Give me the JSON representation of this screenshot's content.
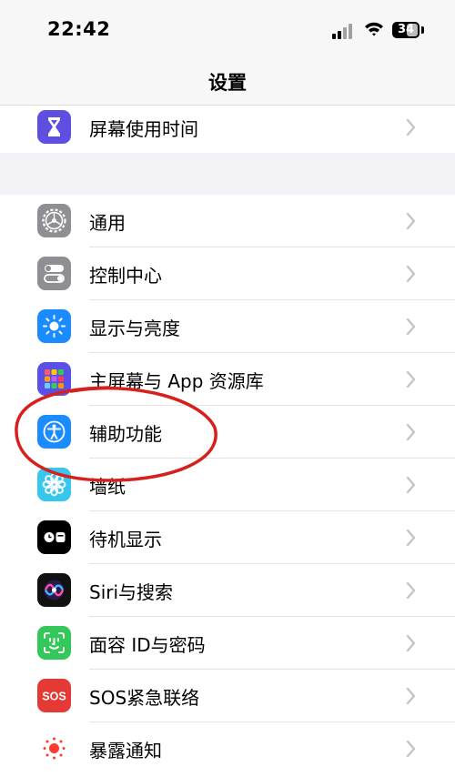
{
  "status_bar": {
    "time": "22:42",
    "battery_level": "34"
  },
  "nav": {
    "title": "设置"
  },
  "group_top": {
    "items": [
      {
        "label": "屏幕使用时间",
        "icon": "hourglass-icon",
        "color": "#5e4fe0"
      }
    ]
  },
  "group_main": {
    "items": [
      {
        "label": "通用",
        "icon": "gear-icon",
        "color": "#8e8e93"
      },
      {
        "label": "控制中心",
        "icon": "toggles-icon",
        "color": "#8e8e93"
      },
      {
        "label": "显示与亮度",
        "icon": "sun-icon",
        "color": "#1a8cff"
      },
      {
        "label": "主屏幕与 App 资源库",
        "icon": "app-grid-icon",
        "color": "#5b50e6"
      },
      {
        "label": "辅助功能",
        "icon": "accessibility-icon",
        "color": "#1a8cff"
      },
      {
        "label": "墙纸",
        "icon": "flower-icon",
        "color": "#36c6ee"
      },
      {
        "label": "待机显示",
        "icon": "standby-icon",
        "color": "#000000"
      },
      {
        "label": "Siri与搜索",
        "icon": "siri-icon",
        "color": "#111111"
      },
      {
        "label": "面容 ID与密码",
        "icon": "face-id-icon",
        "color": "#34c759"
      },
      {
        "label": "SOS紧急联络",
        "icon": "sos-icon",
        "color": "#e53935"
      },
      {
        "label": "暴露通知",
        "icon": "exposure-icon",
        "color": "#ffffff"
      }
    ]
  },
  "annotation": {
    "highlighted_item": "辅助功能",
    "stroke_color": "#d6201c"
  },
  "colors": {
    "background": "#f2f2f7",
    "chevron": "#c4c4c7"
  }
}
